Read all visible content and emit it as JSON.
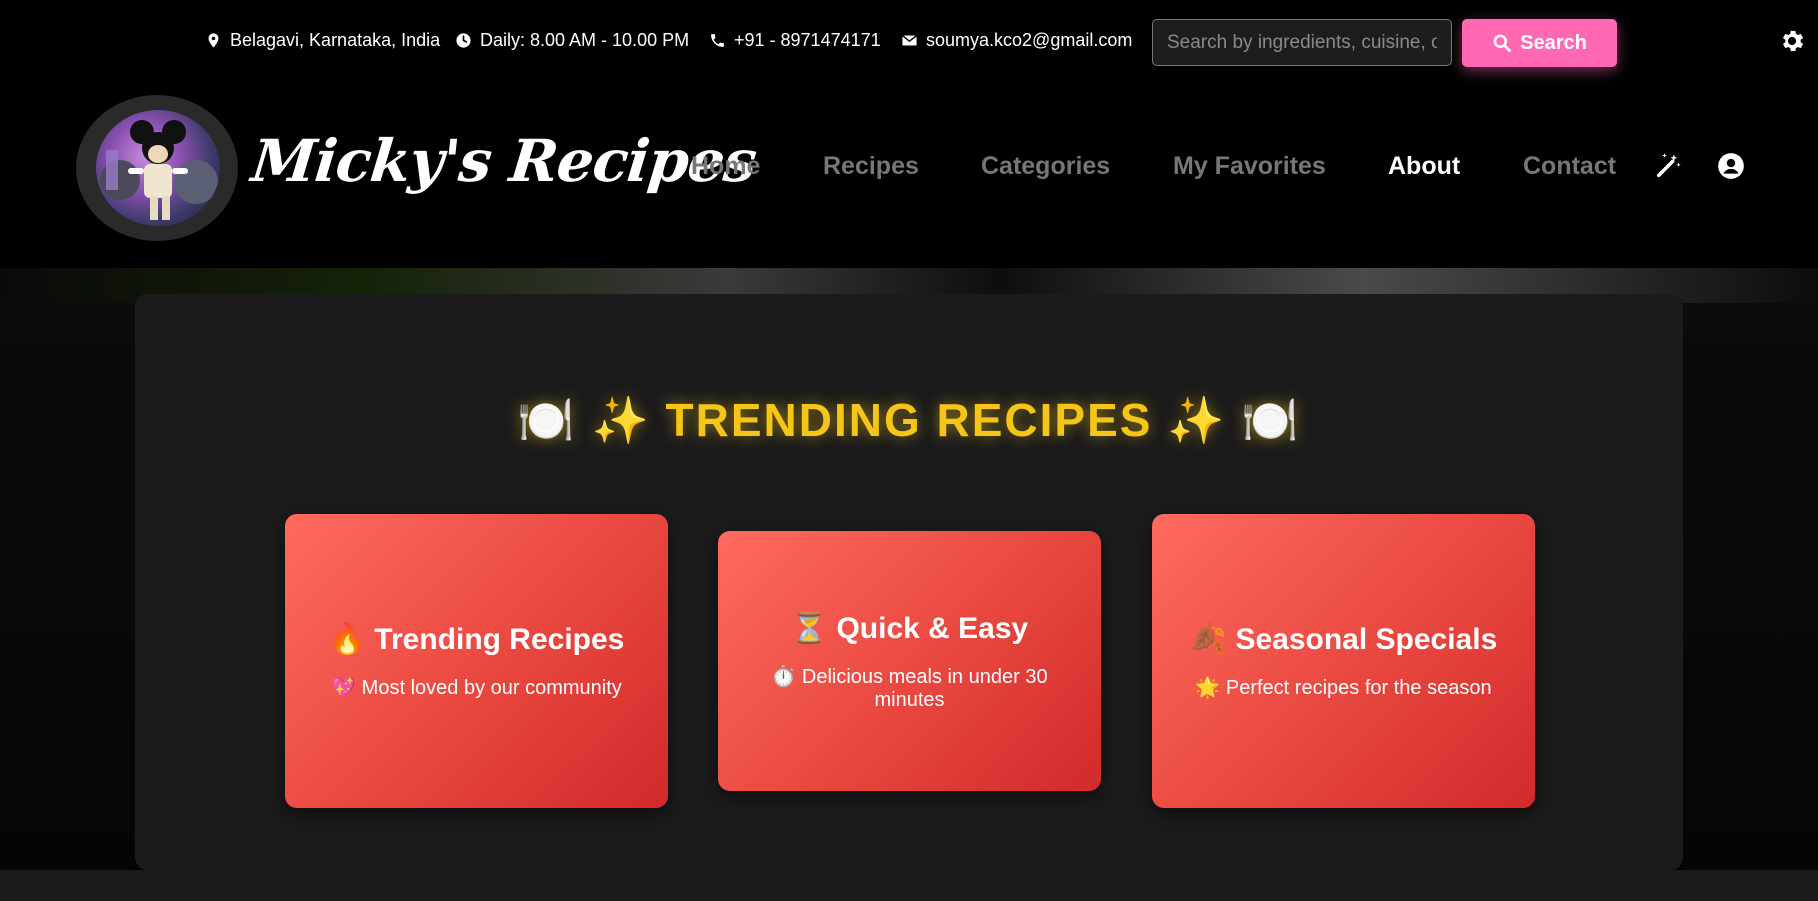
{
  "topbar": {
    "location": "Belagavi, Karnataka, India",
    "hours": "Daily: 8.00 AM - 10.00 PM",
    "phone": "+91 - 8971474171",
    "email": "soumya.kco2@gmail.com",
    "search_placeholder": "Search by ingredients, cuisine, or dish...",
    "search_label": "Search"
  },
  "brand": {
    "name": "Micky's Recipes"
  },
  "nav": {
    "items": [
      {
        "label": "Home"
      },
      {
        "label": "Recipes"
      },
      {
        "label": "Categories"
      },
      {
        "label": "My Favorites"
      },
      {
        "label": "About"
      },
      {
        "label": "Contact"
      }
    ],
    "active": "About"
  },
  "trending": {
    "title": "🍽️ ✨ TRENDING RECIPES ✨ 🍽️",
    "cards": [
      {
        "title": "🔥 Trending Recipes",
        "desc": "💖 Most loved by our community"
      },
      {
        "title": "⏳ Quick & Easy",
        "desc": "⏱️ Delicious meals in under 30 minutes"
      },
      {
        "title": "🍂 Seasonal Specials",
        "desc": "🌟 Perfect recipes for the season"
      }
    ]
  },
  "colors": {
    "accent_pink": "#ff69b4",
    "title_gold": "#f5c518",
    "card_red": "#e8473f",
    "nav_inactive": "#777777"
  },
  "icons": {
    "location": "map-pin-icon",
    "hours": "clock-icon",
    "phone": "phone-icon",
    "email": "envelope-icon",
    "search": "search-icon",
    "settings": "gear-icon",
    "magic": "magic-wand-icon",
    "user": "user-circle-icon"
  }
}
